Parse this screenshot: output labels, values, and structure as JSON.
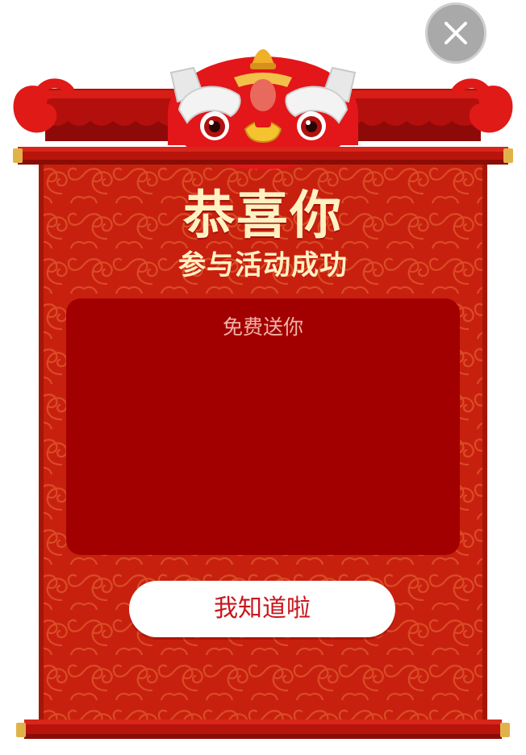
{
  "dialog": {
    "title": "恭喜你",
    "subtitle": "参与活动成功",
    "panel_caption": "免费送你",
    "confirm_label": "我知道啦"
  },
  "icons": {
    "close": "close-icon",
    "lion": "lion-dance-head-icon"
  },
  "colors": {
    "scroll_red": "#c8200f",
    "panel_red": "#a20000",
    "title_cream": "#fff1c2",
    "button_text": "#c8161d",
    "close_gray": "#a9a9a9",
    "rod_gold": "#e2b24a"
  }
}
